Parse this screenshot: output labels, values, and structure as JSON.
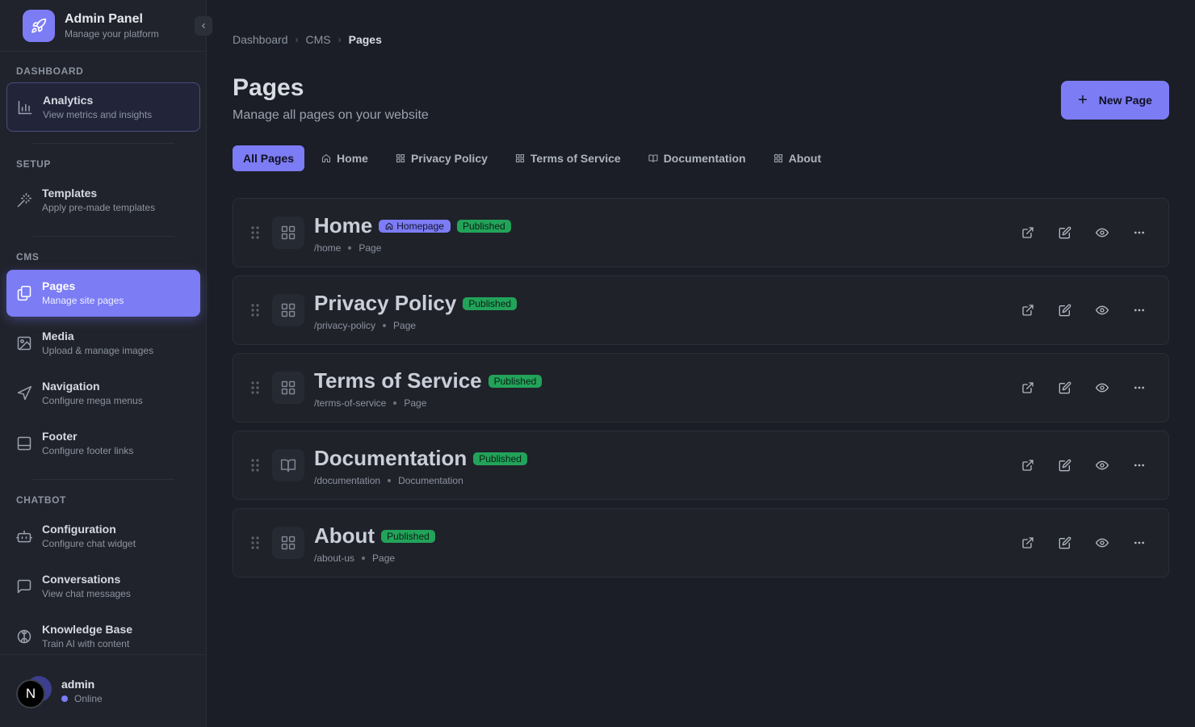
{
  "brand": {
    "title": "Admin Panel",
    "subtitle": "Manage your platform"
  },
  "sidebar": {
    "sections": [
      {
        "label": "DASHBOARD"
      },
      {
        "label": "SETUP"
      },
      {
        "label": "CMS"
      },
      {
        "label": "CHATBOT"
      }
    ],
    "items": [
      {
        "title": "Analytics",
        "subtitle": "View metrics and insights",
        "icon": "bar-chart-icon",
        "state": "outlined"
      },
      {
        "title": "Templates",
        "subtitle": "Apply pre-made templates",
        "icon": "magic-wand-icon"
      },
      {
        "title": "Pages",
        "subtitle": "Manage site pages",
        "icon": "pages-icon",
        "state": "active"
      },
      {
        "title": "Media",
        "subtitle": "Upload & manage images",
        "icon": "image-icon"
      },
      {
        "title": "Navigation",
        "subtitle": "Configure mega menus",
        "icon": "navigation-icon"
      },
      {
        "title": "Footer",
        "subtitle": "Configure footer links",
        "icon": "footer-icon"
      },
      {
        "title": "Configuration",
        "subtitle": "Configure chat widget",
        "icon": "bot-icon"
      },
      {
        "title": "Conversations",
        "subtitle": "View chat messages",
        "icon": "chat-icon"
      },
      {
        "title": "Knowledge Base",
        "subtitle": "Train AI with content",
        "icon": "brain-icon"
      }
    ]
  },
  "user": {
    "initial": "N",
    "name": "admin",
    "status": "Online"
  },
  "breadcrumb": [
    "Dashboard",
    "CMS",
    "Pages"
  ],
  "header": {
    "title": "Pages",
    "subtitle": "Manage all pages on your website",
    "new_button": "New Page"
  },
  "tabs": [
    {
      "label": "All Pages",
      "active": true
    },
    {
      "label": "Home",
      "icon": "home-icon"
    },
    {
      "label": "Privacy Policy",
      "icon": "grid-icon"
    },
    {
      "label": "Terms of Service",
      "icon": "grid-icon"
    },
    {
      "label": "Documentation",
      "icon": "book-icon"
    },
    {
      "label": "About",
      "icon": "grid-icon"
    }
  ],
  "pages": [
    {
      "title": "Home",
      "homepage_badge": "Homepage",
      "status": "Published",
      "slug": "/home",
      "type": "Page",
      "icon": "grid-icon"
    },
    {
      "title": "Privacy Policy",
      "status": "Published",
      "slug": "/privacy-policy",
      "type": "Page",
      "icon": "grid-icon"
    },
    {
      "title": "Terms of Service",
      "status": "Published",
      "slug": "/terms-of-service",
      "type": "Page",
      "icon": "grid-icon"
    },
    {
      "title": "Documentation",
      "status": "Published",
      "slug": "/documentation",
      "type": "Documentation",
      "icon": "book-icon"
    },
    {
      "title": "About",
      "status": "Published",
      "slug": "/about-us",
      "type": "Page",
      "icon": "grid-icon"
    }
  ],
  "colors": {
    "accent": "#7c7cf5",
    "published": "#22a35a",
    "background": "#1b1e26",
    "sidebar": "#20232b"
  }
}
